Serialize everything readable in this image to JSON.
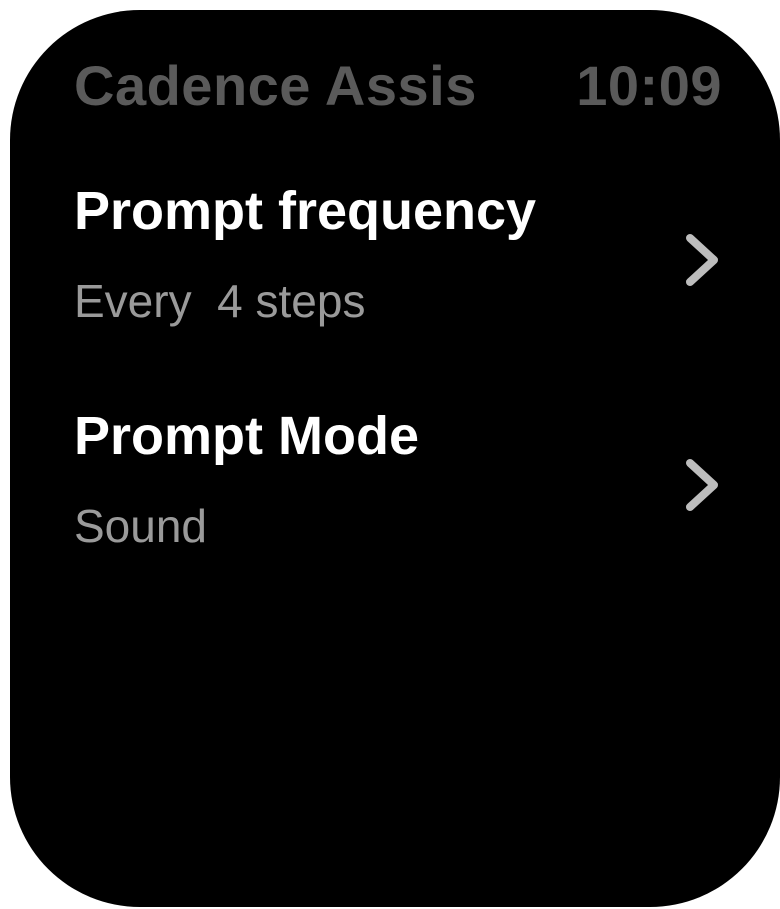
{
  "status_bar": {
    "app_title": "Cadence Assis",
    "time": "10:09"
  },
  "settings": [
    {
      "title": "Prompt frequency",
      "value": "Every  4 steps",
      "icon": "chevron-right-icon"
    },
    {
      "title": "Prompt Mode",
      "value": "Sound",
      "icon": "chevron-right-icon"
    }
  ],
  "colors": {
    "background": "#000000",
    "title_text": "#ffffff",
    "value_text": "#9a9a9a",
    "status_text": "#5a5a5a",
    "chevron": "#bdbdbd"
  }
}
